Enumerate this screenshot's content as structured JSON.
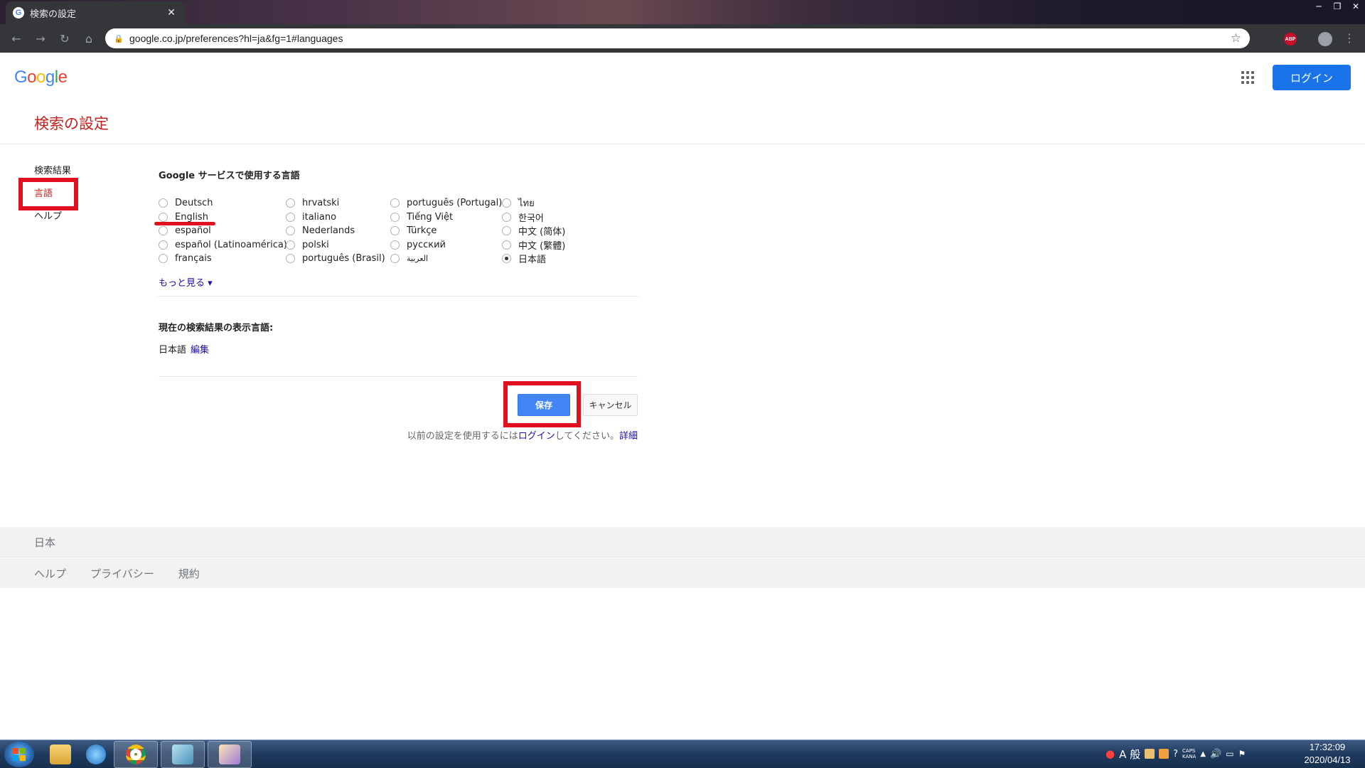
{
  "browser": {
    "tab_title": "検索の設定",
    "tab_close": "✕",
    "url": "google.co.jp/preferences?hl=ja&fg=1#languages",
    "abp_label": "ABP",
    "window_controls": {
      "minimize": "─",
      "restore": "❐",
      "close": "✕"
    }
  },
  "header": {
    "logo": {
      "g1": "G",
      "o1": "o",
      "o2": "o",
      "g2": "g",
      "l": "l",
      "e": "e"
    },
    "login_label": "ログイン",
    "page_title": "検索の設定"
  },
  "sidebar": {
    "items": [
      {
        "label": "検索結果"
      },
      {
        "label": "言語"
      },
      {
        "label": "ヘルプ"
      }
    ]
  },
  "languages": {
    "heading": "Google サービスで使用する言語",
    "columns": [
      [
        "Deutsch",
        "English",
        "español",
        "español (Latinoamérica)",
        "français"
      ],
      [
        "hrvatski",
        "italiano",
        "Nederlands",
        "polski",
        "português (Brasil)"
      ],
      [
        "português (Portugal)",
        "Tiếng Việt",
        "Türkçe",
        "русский",
        "العربية"
      ],
      [
        "ไทย",
        "한국어",
        "中文 (简体)",
        "中文 (繁體)",
        "日本語"
      ]
    ],
    "selected": "日本語",
    "more_link": "もっと見る ▾"
  },
  "current": {
    "heading": "現在の検索結果の表示言語:",
    "value": "日本語",
    "edit_link": "編集"
  },
  "actions": {
    "save_label": "保存",
    "cancel_label": "キャンセル",
    "note_prefix": "以前の設定を使用するには",
    "note_login": "ログイン",
    "note_suffix": "してください。",
    "note_detail": "詳細"
  },
  "footer": {
    "country": "日本",
    "links": [
      "ヘルプ",
      "プライバシー",
      "規約"
    ]
  },
  "taskbar": {
    "tray": {
      "ime": "A 般",
      "caps": "CAPS",
      "kana": "KANA"
    },
    "clock_time": "17:32:09",
    "clock_date": "2020/04/13"
  },
  "colors": {
    "accent_blue": "#1a73e8",
    "save_blue": "#4285f4",
    "title_red": "#c5221f",
    "highlight_red": "#e0101e",
    "link_blue": "#1a0dab"
  }
}
